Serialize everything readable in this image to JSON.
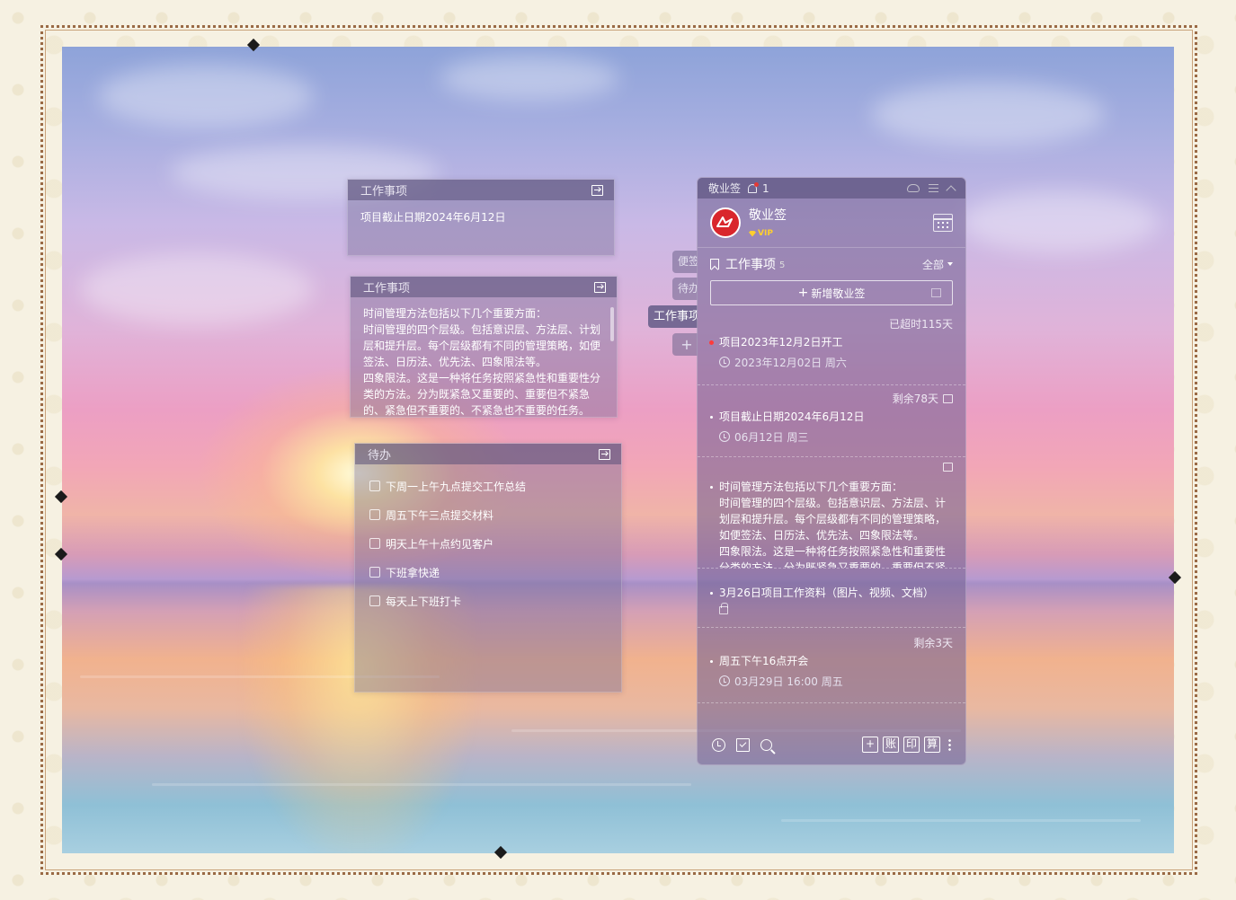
{
  "notes": [
    {
      "header": "工作事项",
      "body": "项目截止日期2024年6月12日"
    },
    {
      "header": "工作事项",
      "lines": [
        "时间管理方法包括以下几个重要方面：",
        "时间管理的四个层级。包括意识层、方法层、计划",
        "层和提升层。每个层级都有不同的管理策略，如便",
        "签法、日历法、优先法、四象限法等。",
        "四象限法。这是一种将任务按照紧急性和重要性分",
        "类的方法。分为既紧急又重要的、重要但不紧急",
        "的、紧急但不重要的、不紧急也不重要的任务。"
      ]
    },
    {
      "header": "待办",
      "items": [
        "下周一上午九点提交工作总结",
        "周五下午三点提交材料",
        "明天上午十点约见客户",
        "下班拿快递",
        "每天上下班打卡"
      ]
    }
  ],
  "side_tabs": {
    "tab1": "便签",
    "tab2": "待办",
    "tab3": "工作事项",
    "add": "+"
  },
  "app": {
    "titlebar": {
      "title": "敬业签",
      "bell_count": "1"
    },
    "profile": {
      "name": "敬业签",
      "badge": "VIP"
    },
    "section": {
      "title": "工作事项",
      "count": "5",
      "filter": "全部"
    },
    "add_button": "新增敬业签",
    "tasks": [
      {
        "meta": "已超时115天",
        "title": "项目2023年12月2日开工",
        "date": "2023年12月02日 周六"
      },
      {
        "meta": "剩余78天",
        "title": "项目截止日期2024年6月12日",
        "date": "06月12日 周三"
      },
      {
        "lines": [
          "时间管理方法包括以下几个重要方面：",
          "时间管理的四个层级。包括意识层、方法层、计",
          "划层和提升层。每个层级都有不同的管理策略，",
          "如便签法、日历法、优先法、四象限法等。",
          "四象限法。这是一种将任务按照紧急性和重要性",
          "分类的方法。分为既紧急又重要的、重要但不紧"
        ]
      },
      {
        "title": "3月26日项目工作资料（图片、视频、文档）"
      },
      {
        "meta": "剩余3天",
        "title": "周五下午16点开会",
        "date": "03月29日 16:00 周五"
      }
    ],
    "footer": {
      "btn_account": "账",
      "btn_print": "印",
      "btn_calc": "算"
    }
  },
  "icons": [
    "exit-icon",
    "bell-icon",
    "cloud-icon",
    "menu-icon",
    "chevron-up-icon",
    "calendar-icon",
    "bookmark-icon",
    "clock-icon",
    "lock-icon",
    "check-icon",
    "search-icon",
    "plus-icon",
    "more-icon"
  ],
  "colors": {
    "accent_red": "#d9262c",
    "vip_gold": "#ffcf2e",
    "panel": "#7664940",
    "overdue_dot": "#ff3b3b"
  }
}
